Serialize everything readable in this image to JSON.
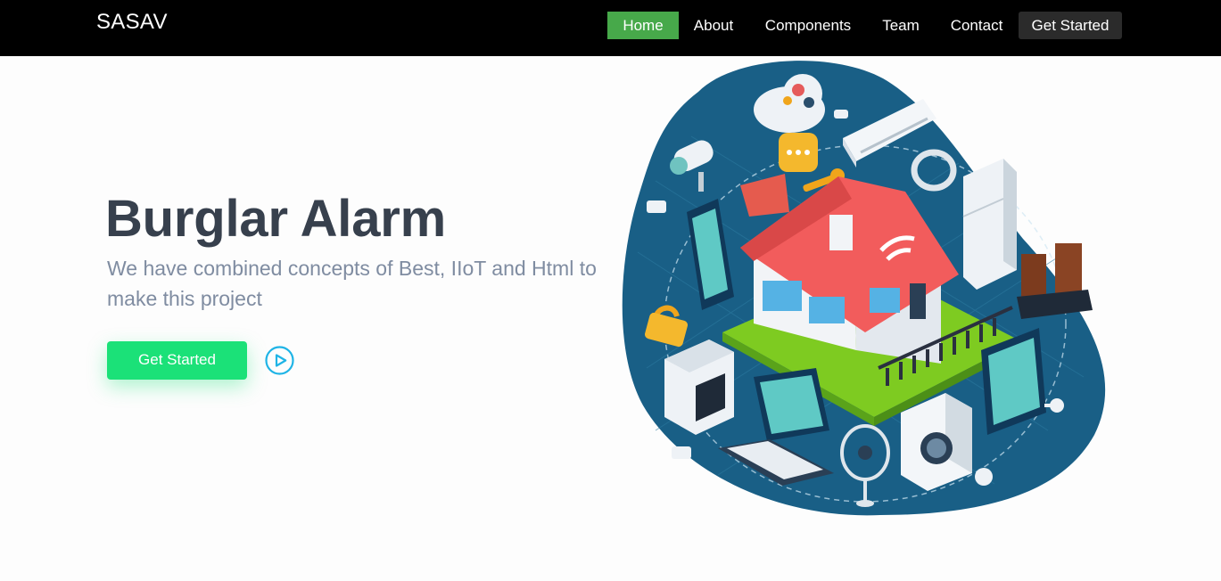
{
  "brand": {
    "name": "SASAV"
  },
  "nav": {
    "home": "Home",
    "about": "About",
    "components": "Components",
    "team": "Team",
    "contact": "Contact",
    "get_started": "Get Started"
  },
  "hero": {
    "title": "Burglar Alarm",
    "subtitle": "We have combined concepts of Best, IIoT and Html to make this project",
    "cta_label": "Get Started"
  },
  "icons": {
    "play": "play-circle-icon",
    "illustration": "smart-home-iot-illustration"
  },
  "colors": {
    "navbar": "#000000",
    "nav_active": "#47a94a",
    "cta_dark": "#2b2b2b",
    "hero_button": "#1be178",
    "title_text": "#37404d",
    "subtitle_text": "#7f8ca1",
    "play_icon": "#1fb4e6",
    "blob": "#195f86"
  }
}
